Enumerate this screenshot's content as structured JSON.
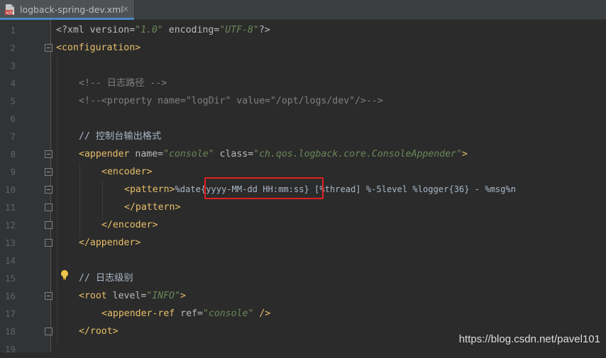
{
  "tab": {
    "file_name": "logback-spring-dev.xml",
    "close_glyph": "✕"
  },
  "lines": [
    {
      "n": "1"
    },
    {
      "n": "2"
    },
    {
      "n": "3"
    },
    {
      "n": "4"
    },
    {
      "n": "5"
    },
    {
      "n": "6"
    },
    {
      "n": "7"
    },
    {
      "n": "8"
    },
    {
      "n": "9"
    },
    {
      "n": "10"
    },
    {
      "n": "11"
    },
    {
      "n": "12"
    },
    {
      "n": "13"
    },
    {
      "n": "14"
    },
    {
      "n": "15"
    },
    {
      "n": "16"
    },
    {
      "n": "17"
    },
    {
      "n": "18"
    },
    {
      "n": "19"
    }
  ],
  "code": {
    "l1_open": "<?xml version=",
    "l1_v1": "\"1.0\"",
    "l1_mid": " encoding=",
    "l1_v2": "\"UTF-8\"",
    "l1_close": "?>",
    "l2": "<configuration>",
    "l4": "<!-- 日志路径 -->",
    "l5": "<!--<property name=\"logDir\" value=\"/opt/logs/dev\"/>-->",
    "l7": "// 控制台输出格式",
    "l8_tag": "<appender",
    "l8_a1": " name=",
    "l8_v1": "\"console\"",
    "l8_a2": " class=",
    "l8_v2": "\"ch.qos.logback.core.ConsoleAppender\"",
    "l8_close": ">",
    "l9": "<encoder>",
    "l10_tag": "<pattern>",
    "l10_text": "%date{yyyy-MM-dd HH:mm:ss} [%thread] %-5level %logger{36} - %msg%n",
    "l11": "</pattern>",
    "l12": "</encoder>",
    "l13": "</appender>",
    "l15": "// 日志级别",
    "l16_tag": "<root",
    "l16_a1": " level=",
    "l16_v1": "\"INFO\"",
    "l16_close": ">",
    "l17_tag": "<appender-ref",
    "l17_a1": " ref=",
    "l17_v1": "\"console\"",
    "l17_close": " />",
    "l18": "</root>"
  },
  "watermark": "https://blog.csdn.net/pavel101",
  "colors": {
    "tag": "#e8bf6a",
    "value": "#6a8759",
    "comment": "#808080",
    "highlight": "#e02020"
  }
}
